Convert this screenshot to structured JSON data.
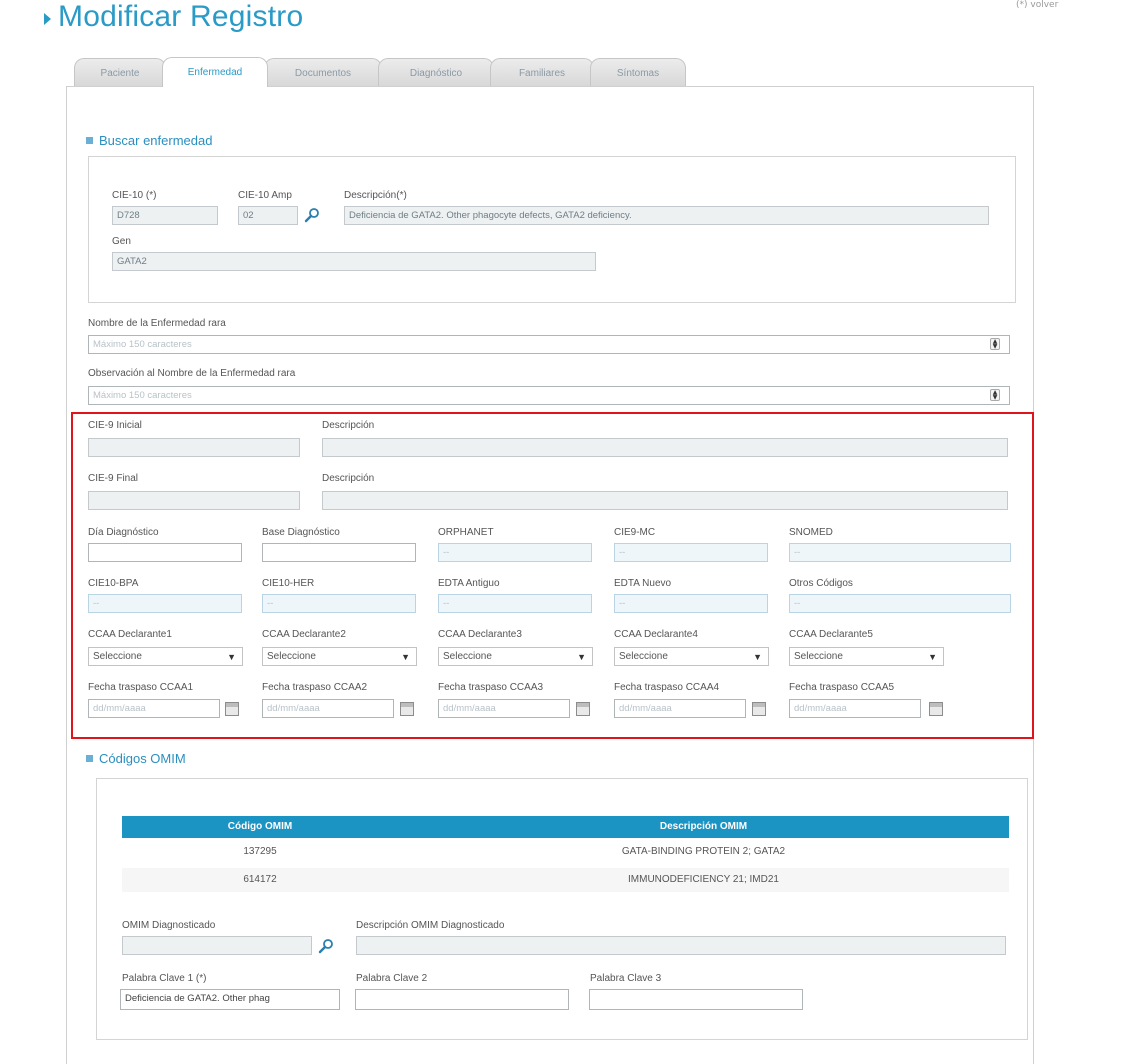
{
  "page": {
    "title": "Modificar Registro",
    "top_right": "(*) volver"
  },
  "tabs": [
    {
      "label": "Paciente",
      "active": false
    },
    {
      "label": "Enfermedad",
      "active": true
    },
    {
      "label": "Documentos",
      "active": false
    },
    {
      "label": "Diagnóstico",
      "active": false
    },
    {
      "label": "Familiares",
      "active": false
    },
    {
      "label": "Síntomas",
      "active": false
    }
  ],
  "buscar": {
    "title": "Buscar enfermedad",
    "cie10_label": "CIE-10 (*)",
    "cie10_value": "D728",
    "cie10amp_label": "CIE-10 Amp",
    "cie10amp_value": "02",
    "descripcion_label": "Descripción(*)",
    "descripcion_value": "Deficiencia de GATA2. Other phagocyte defects, GATA2 deficiency.",
    "gen_label": "Gen",
    "gen_value": "GATA2"
  },
  "nombre": {
    "label": "Nombre de la Enfermedad rara",
    "placeholder": "Máximo 150 caracteres"
  },
  "observacion": {
    "label": "Observación al Nombre de la Enfermedad rara",
    "placeholder": "Máximo 150 caracteres"
  },
  "codes": {
    "cie9_inicial_label": "CIE-9 Inicial",
    "descripcion1_label": "Descripción",
    "cie9_final_label": "CIE-9 Final",
    "descripcion2_label": "Descripción",
    "dia_diagnostico_label": "Día Diagnóstico",
    "base_diagnostico_label": "Base Diagnóstico",
    "orphanet_label": "ORPHANET",
    "cie9mc_label": "CIE9-MC",
    "snomed_label": "SNOMED",
    "cie10bpa_label": "CIE10-BPA",
    "cie10her_label": "CIE10-HER",
    "edta_antiguo_label": "EDTA Antiguo",
    "edta_nuevo_label": "EDTA Nuevo",
    "otros_codigos_label": "Otros Códigos",
    "empty_value": "--",
    "ccaa": [
      {
        "label": "CCAA Declarante1",
        "value": "Seleccione"
      },
      {
        "label": "CCAA Declarante2",
        "value": "Seleccione"
      },
      {
        "label": "CCAA Declarante3",
        "value": "Seleccione"
      },
      {
        "label": "CCAA Declarante4",
        "value": "Seleccione"
      },
      {
        "label": "CCAA Declarante5",
        "value": "Seleccione"
      }
    ],
    "fechas": [
      {
        "label": "Fecha traspaso CCAA1",
        "placeholder": "dd/mm/aaaa"
      },
      {
        "label": "Fecha traspaso CCAA2",
        "placeholder": "dd/mm/aaaa"
      },
      {
        "label": "Fecha traspaso CCAA3",
        "placeholder": "dd/mm/aaaa"
      },
      {
        "label": "Fecha traspaso CCAA4",
        "placeholder": "dd/mm/aaaa"
      },
      {
        "label": "Fecha traspaso CCAA5",
        "placeholder": "dd/mm/aaaa"
      }
    ]
  },
  "omim": {
    "title": "Códigos OMIM",
    "col_codigo": "Código OMIM",
    "col_descripcion": "Descripción OMIM",
    "rows": [
      {
        "codigo": "137295",
        "descripcion": "GATA-BINDING PROTEIN 2; GATA2"
      },
      {
        "codigo": "614172",
        "descripcion": "IMMUNODEFICIENCY 21; IMD21"
      }
    ],
    "diagnosticado_label": "OMIM Diagnosticado",
    "desc_diagnosticado_label": "Descripción OMIM Diagnosticado",
    "palabra1_label": "Palabra Clave 1 (*)",
    "palabra1_value": "Deficiencia de GATA2. Other phag",
    "palabra2_label": "Palabra Clave 2",
    "palabra3_label": "Palabra Clave 3"
  },
  "icons": {
    "search": "magnifier-icon",
    "calendar": "calendar-icon",
    "dropdown": "chevron-down-icon",
    "spinner": "spinner-arrows-icon"
  },
  "colors": {
    "accent": "#2a9ac7",
    "table_header": "#1b93c3",
    "highlight_border": "#e0151c"
  }
}
